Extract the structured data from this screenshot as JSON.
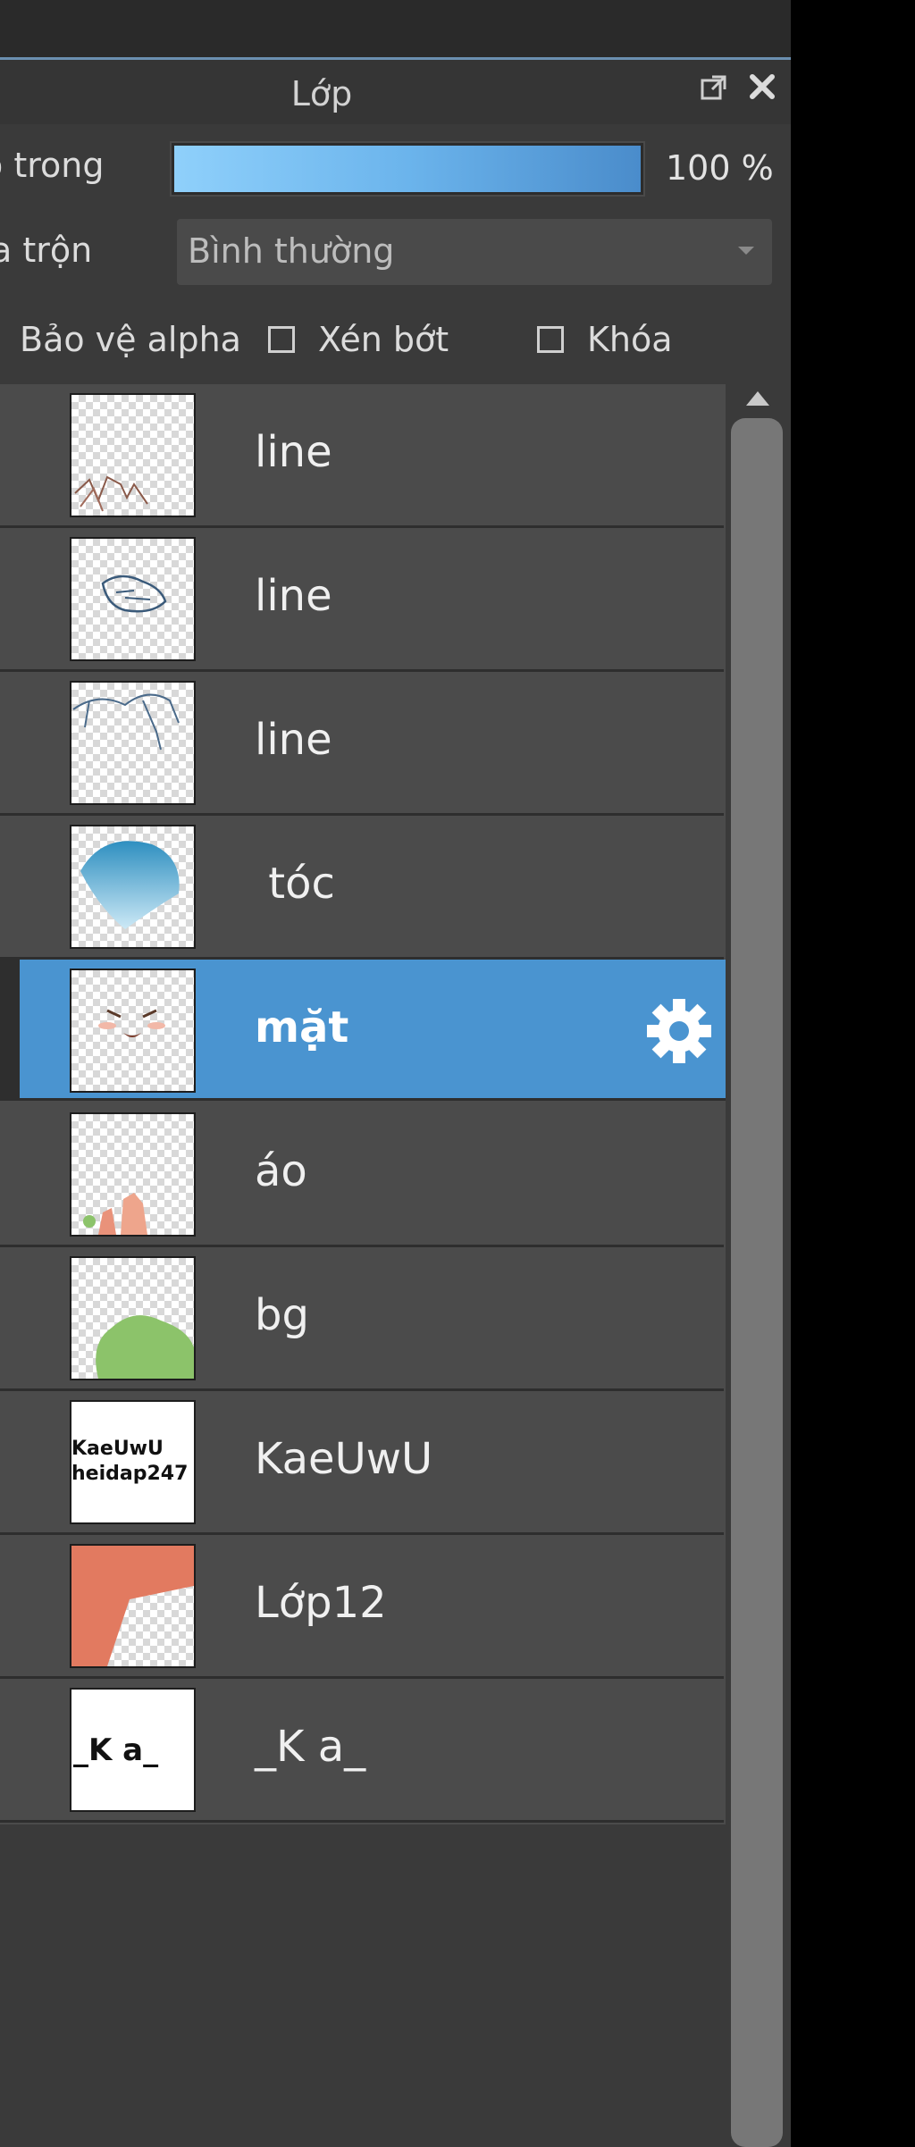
{
  "panel": {
    "title": "Lớp"
  },
  "opacity": {
    "label": "ộ trong",
    "value_text": "100 %",
    "fill_fraction": 1.0
  },
  "blend": {
    "label": "a trộn",
    "value": "Bình thường"
  },
  "options": {
    "protect_alpha": "Bảo vệ alpha",
    "clip": "Xén bớt",
    "lock": "Khóa"
  },
  "layers": [
    {
      "name": "line",
      "selected": false
    },
    {
      "name": "line",
      "selected": false
    },
    {
      "name": "line",
      "selected": false
    },
    {
      "name": " tóc",
      "selected": false
    },
    {
      "name": "mặt",
      "selected": true
    },
    {
      "name": "áo",
      "selected": false
    },
    {
      "name": "bg",
      "selected": false
    },
    {
      "name": "KaeUwU",
      "selected": false
    },
    {
      "name": "Lớp12",
      "selected": false
    },
    {
      "name": "_K a_",
      "selected": false
    }
  ],
  "thumbnail_text": {
    "kaeuwu_line1": "KaeUwU",
    "kaeuwu_line2": "heidap247",
    "ka": "_K a_"
  },
  "colors": {
    "selected_row": "#4a94d0",
    "slider_fill": "#6bb4ec",
    "panel_bg": "#3a3a3a",
    "row_bg": "#4b4b4b"
  }
}
